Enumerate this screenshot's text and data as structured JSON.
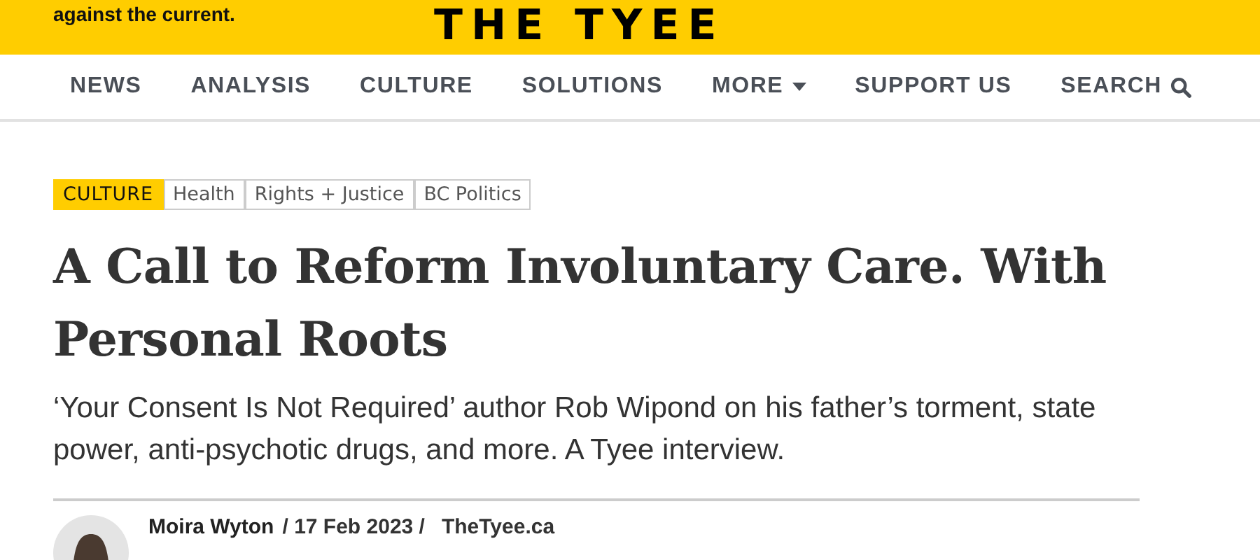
{
  "header": {
    "tagline": "against the current.",
    "logo": "THE TYEE"
  },
  "nav": [
    {
      "label": "NEWS",
      "kind": "link"
    },
    {
      "label": "ANALYSIS",
      "kind": "link"
    },
    {
      "label": "CULTURE",
      "kind": "link"
    },
    {
      "label": "SOLUTIONS",
      "kind": "link"
    },
    {
      "label": "MORE",
      "kind": "dropdown"
    },
    {
      "label": "SUPPORT US",
      "kind": "link"
    },
    {
      "label": "SEARCH",
      "kind": "search"
    }
  ],
  "tags": [
    {
      "label": "CULTURE",
      "selected": true
    },
    {
      "label": "Health",
      "selected": false
    },
    {
      "label": "Rights + Justice",
      "selected": false
    },
    {
      "label": "BC Politics",
      "selected": false
    }
  ],
  "article": {
    "title": "A Call to Reform Involuntary Care. With Personal Roots",
    "subtitle": "‘Your Consent Is Not Required’ author Rob Wipond on his father’s torment, state power, anti-psychotic drugs, and more. A Tyee interview.",
    "byline": {
      "author": "Moira Wyton",
      "date": "/ 17 Feb 2023 /",
      "source": "TheTyee.ca"
    }
  }
}
